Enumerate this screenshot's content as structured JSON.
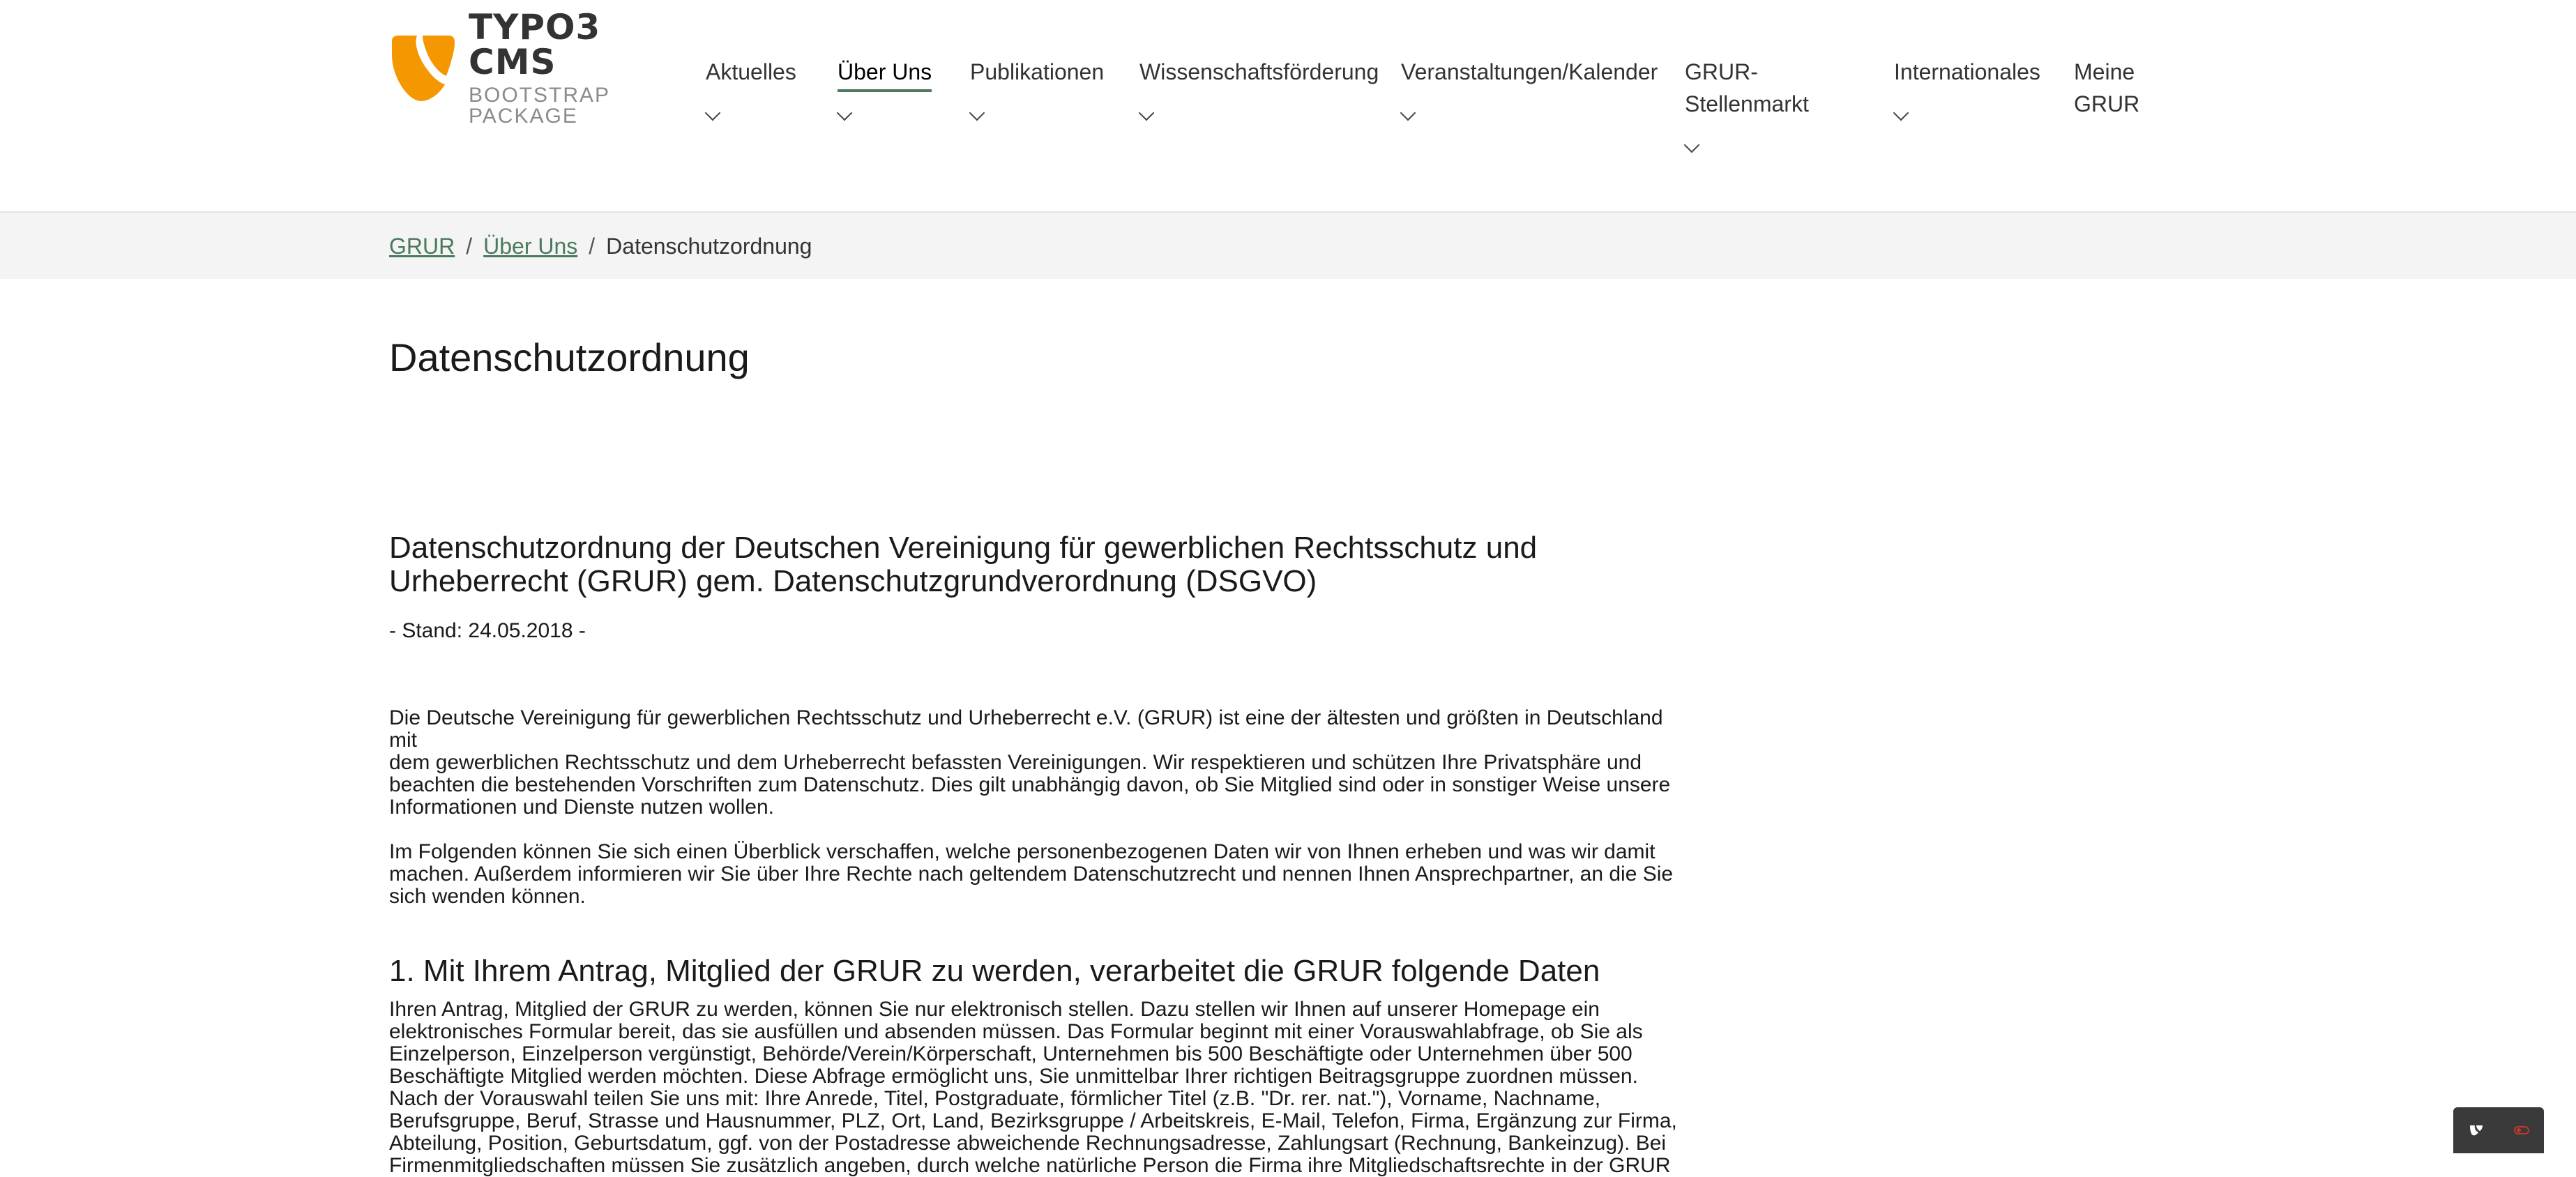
{
  "logo": {
    "title": "TYPO3 CMS",
    "subtitle": "BOOTSTRAP PACKAGE",
    "icon": "typo3-logo-icon",
    "color": "#f49700"
  },
  "nav": [
    {
      "label": "Aktuelles",
      "dropdown": true,
      "active": false
    },
    {
      "label": "Über Uns",
      "dropdown": true,
      "active": true
    },
    {
      "label": "Publikationen",
      "dropdown": true,
      "active": false
    },
    {
      "label": "Wissenschaftsförderung",
      "dropdown": true,
      "active": false
    },
    {
      "label": "Veranstaltungen/Kalender",
      "dropdown": true,
      "active": false
    },
    {
      "label": "GRUR-Stellenmarkt",
      "line1": "GRUR-",
      "line2": "Stellenmarkt",
      "dropdown": true,
      "active": false
    },
    {
      "label": "Internationales",
      "dropdown": true,
      "active": false
    },
    {
      "label": "Meine GRUR",
      "line1": "Meine",
      "line2": "GRUR",
      "dropdown": false,
      "active": false
    }
  ],
  "breadcrumb": {
    "items": [
      "GRUR",
      "Über Uns"
    ],
    "current": "Datenschutzordnung",
    "separator": "/"
  },
  "page": {
    "title": "Datenschutzordnung"
  },
  "content": {
    "heading_line1": "Datenschutzordnung der Deutschen Vereinigung für gewerblichen Rechtsschutz und",
    "heading_line2": "Urheberrecht (GRUR) gem. Datenschutzgrundverordnung (DSGVO)",
    "stand": "- Stand: 24.05.2018 -",
    "intro1": [
      "Die Deutsche Vereinigung für gewerblichen Rechtsschutz und Urheberrecht e.V. (GRUR) ist eine der ältesten und größten in Deutschland mit",
      "dem gewerblichen Rechtsschutz und dem Urheberrecht befassten Vereinigungen. Wir respektieren und schützen Ihre Privatsphäre und",
      "beachten die bestehenden Vorschriften zum Datenschutz. Dies gilt unabhängig davon, ob Sie Mitglied sind oder in sonstiger Weise unsere",
      "Informationen und Dienste nutzen wollen."
    ],
    "intro2": [
      "Im Folgenden können Sie sich einen Überblick verschaffen, welche personenbezogenen Daten wir von Ihnen erheben und was wir damit",
      "machen. Außerdem informieren wir Sie über Ihre Rechte nach geltendem Datenschutzrecht und nennen Ihnen Ansprechpartner, an die Sie",
      "sich wenden können."
    ],
    "section1_heading": "1. Mit Ihrem Antrag, Mitglied der GRUR zu werden, verarbeitet die GRUR folgende Daten",
    "section1_text": [
      "Ihren Antrag, Mitglied der GRUR zu werden, können Sie nur elektronisch stellen. Dazu stellen wir Ihnen auf unserer Homepage ein",
      "elektronisches Formular bereit, das sie ausfüllen und absenden müssen. Das Formular beginnt mit einer Vorauswahlabfrage, ob Sie als",
      "Einzelperson, Einzelperson vergünstigt, Behörde/Verein/Körperschaft, Unternehmen bis 500 Beschäftigte oder Unternehmen über 500",
      "Beschäftigte Mitglied werden möchten. Diese Abfrage ermöglicht uns, Sie unmittelbar Ihrer richtigen Beitragsgruppe zuordnen müssen.",
      "Nach der Vorauswahl teilen Sie uns mit: Ihre Anrede, Titel, Postgraduate, förmlicher Titel (z.B. \"Dr. rer. nat.\"), Vorname, Nachname,",
      "Berufsgruppe, Beruf, Strasse und Hausnummer, PLZ, Ort, Land, Bezirksgruppe / Arbeitskreis, E-Mail, Telefon, Firma, Ergänzung zur Firma,",
      "Abteilung, Position, Geburtsdatum, ggf. von der Postadresse abweichende Rechnungsadresse, Zahlungsart (Rechnung, Bankeinzug). Bei",
      "Firmenmitgliedschaften müssen Sie zusätzlich angeben, durch welche natürliche Person die Firma ihre Mitgliedschaftsrechte in der GRUR"
    ]
  },
  "colors": {
    "accent": "#4a7a5c",
    "breadcrumb_bg": "#f4f4f4"
  }
}
